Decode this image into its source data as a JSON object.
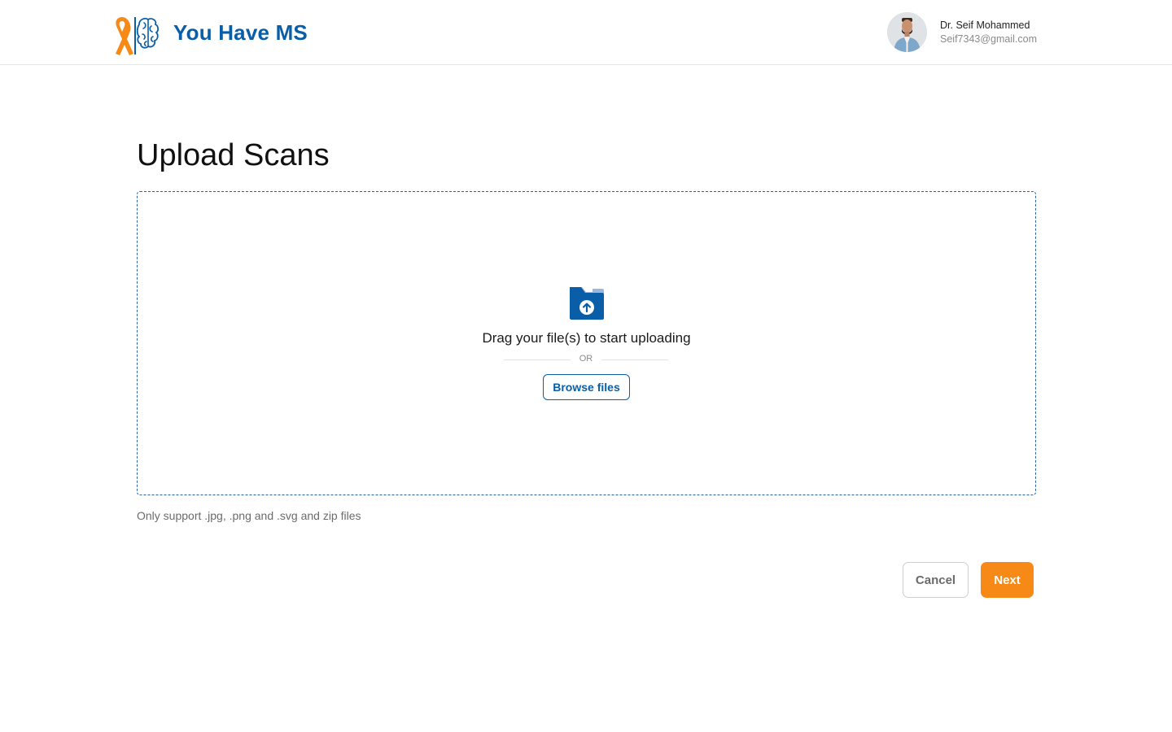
{
  "header": {
    "brand": "You Have MS",
    "logo_icon": "ribbon-brain-logo-icon",
    "user": {
      "name": "Dr. Seif Mohammed",
      "email": "Seif7343@gmail.com",
      "avatar_icon": "user-avatar"
    }
  },
  "main": {
    "title": "Upload Scans",
    "dropzone": {
      "icon": "folder-upload-icon",
      "drag_text": "Drag your file(s) to start uploading",
      "or_text": "OR",
      "browse_label": "Browse files"
    },
    "support_note": "Only support .jpg, .png and .svg and zip files"
  },
  "actions": {
    "cancel_label": "Cancel",
    "next_label": "Next"
  },
  "colors": {
    "brand_blue": "#0a5ea8",
    "accent_orange": "#f78a17",
    "dropzone_border": "#2a62a0"
  }
}
